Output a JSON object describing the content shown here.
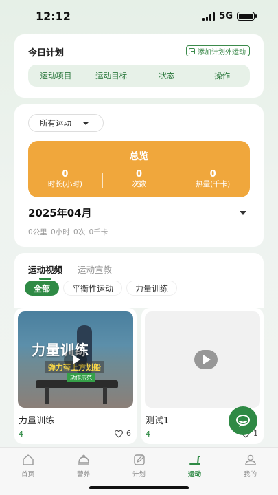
{
  "status_bar": {
    "time": "12:12",
    "network": "5G"
  },
  "today_plan": {
    "title": "今日计划",
    "add_button": "添加计划外运动",
    "columns": [
      "运动项目",
      "运动目标",
      "状态",
      "操作"
    ]
  },
  "overview": {
    "filter_label": "所有运动",
    "title": "总览",
    "stats": [
      {
        "value": "0",
        "label": "时长(小时)"
      },
      {
        "value": "0",
        "label": "次数"
      },
      {
        "value": "0",
        "label": "热量(千卡)"
      }
    ],
    "month": "2025年04月",
    "summary": "0公里 0小时 0次 0千卡"
  },
  "videos": {
    "tabs": [
      "运动视频",
      "运动宣教"
    ],
    "active_tab": 0,
    "categories": [
      "全部",
      "平衡性运动",
      "力量训练"
    ],
    "active_category": 0,
    "items": [
      {
        "title": "力量训练",
        "count": "4",
        "likes": "6",
        "thumb_title": "力量训练",
        "thumb_subtitle": "弹力带上方划船",
        "thumb_tag": "动作示范"
      },
      {
        "title": "测试1",
        "count": "4",
        "likes": "1"
      }
    ]
  },
  "nav": {
    "items": [
      {
        "label": "首页",
        "icon": "home-icon"
      },
      {
        "label": "营养",
        "icon": "cloche-icon"
      },
      {
        "label": "计划",
        "icon": "edit-icon"
      },
      {
        "label": "运动",
        "icon": "treadmill-icon"
      },
      {
        "label": "我的",
        "icon": "user-icon"
      }
    ],
    "active_index": 3
  },
  "colors": {
    "accent_green": "#2f8a45",
    "overview_orange": "#f0a73c"
  }
}
